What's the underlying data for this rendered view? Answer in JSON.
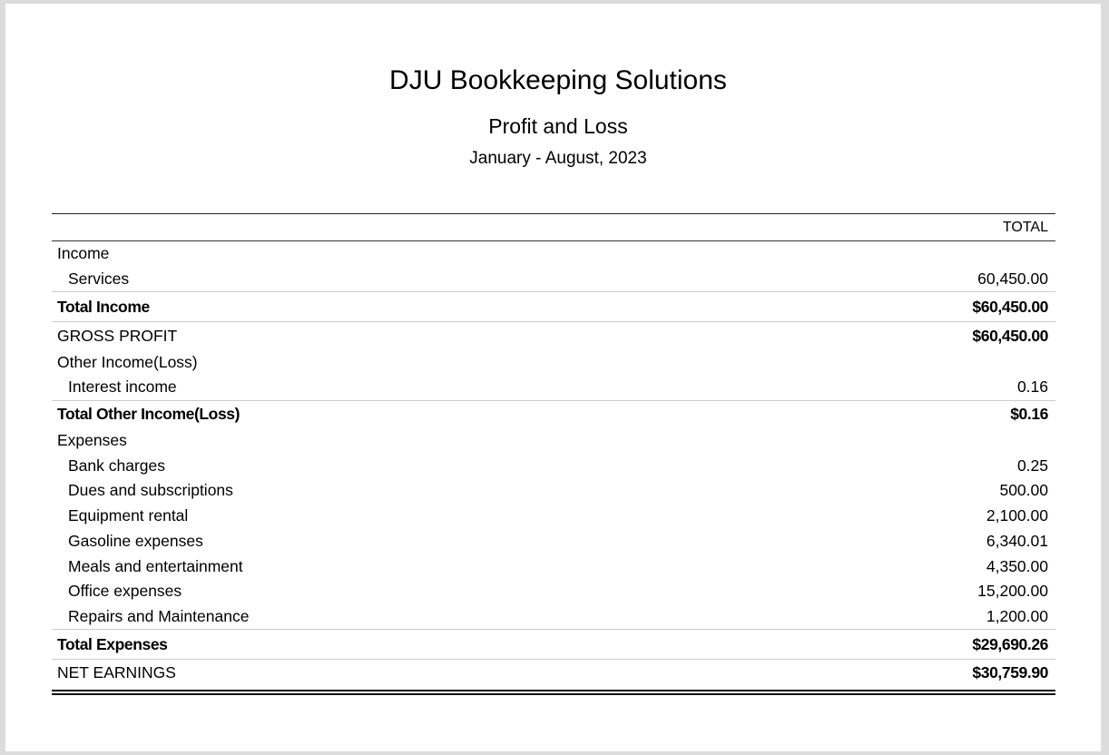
{
  "header": {
    "company": "DJU Bookkeeping Solutions",
    "report": "Profit and Loss",
    "period": "January - August, 2023"
  },
  "table": {
    "column": "TOTAL",
    "income": {
      "label": "Income",
      "items": [
        {
          "label": "Services",
          "value": "60,450.00"
        }
      ],
      "total_label": "Total Income",
      "total": "$60,450.00"
    },
    "gross_profit": {
      "label": "GROSS PROFIT",
      "value": "$60,450.00"
    },
    "other_income": {
      "label": "Other Income(Loss)",
      "items": [
        {
          "label": "Interest income",
          "value": "0.16"
        }
      ],
      "total_label": "Total Other Income(Loss)",
      "total": "$0.16"
    },
    "expenses": {
      "label": "Expenses",
      "items": [
        {
          "label": "Bank charges",
          "value": "0.25"
        },
        {
          "label": "Dues and subscriptions",
          "value": "500.00"
        },
        {
          "label": "Equipment rental",
          "value": "2,100.00"
        },
        {
          "label": "Gasoline expenses",
          "value": "6,340.01"
        },
        {
          "label": "Meals and entertainment",
          "value": "4,350.00"
        },
        {
          "label": "Office expenses",
          "value": "15,200.00"
        },
        {
          "label": "Repairs and Maintenance",
          "value": "1,200.00"
        }
      ],
      "total_label": "Total Expenses",
      "total": "$29,690.26"
    },
    "net_earnings": {
      "label": "NET EARNINGS",
      "value": "$30,759.90"
    }
  }
}
